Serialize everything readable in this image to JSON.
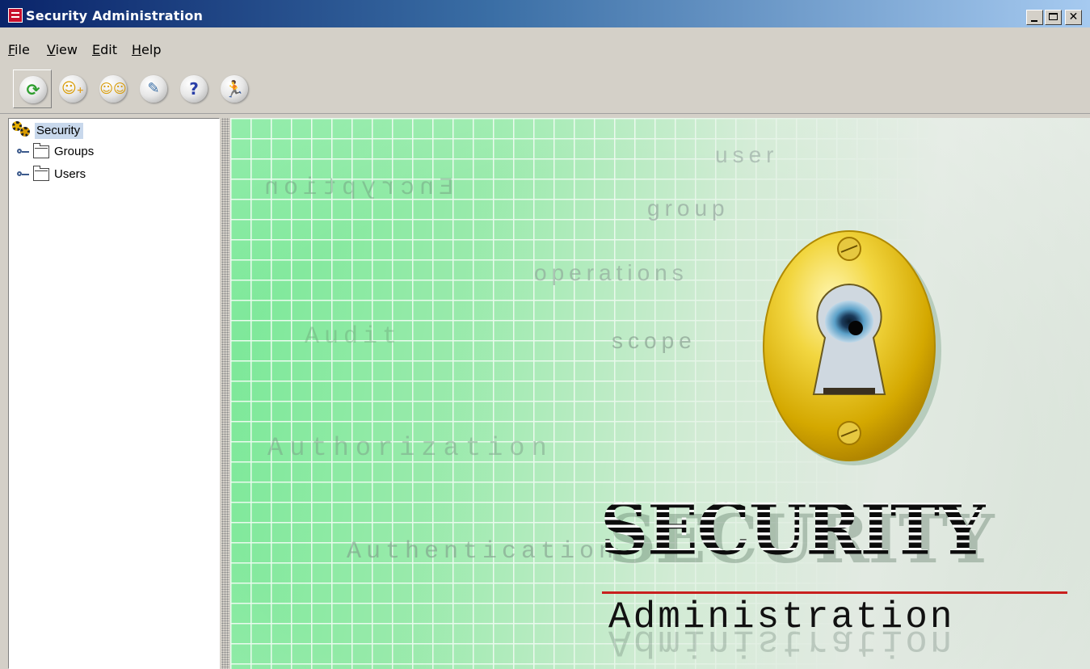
{
  "window": {
    "title": "Security Administration",
    "colors": {
      "titlebar_start": "#0a246a",
      "titlebar_end": "#a6caf0",
      "chrome": "#d4d0c8"
    }
  },
  "menu": {
    "items": [
      {
        "label": "File"
      },
      {
        "label": "View"
      },
      {
        "label": "Edit"
      },
      {
        "label": "Help"
      }
    ]
  },
  "toolbar": {
    "buttons": [
      {
        "icon": "refresh-icon",
        "color": "#2e9e2e"
      },
      {
        "icon": "add-user-icon",
        "color": "#e0a020"
      },
      {
        "icon": "add-group-icon",
        "color": "#e0a020"
      },
      {
        "icon": "edit-icon",
        "color": "#3a6ea5"
      },
      {
        "icon": "help-icon",
        "color": "#2a3fa8"
      },
      {
        "icon": "exit-icon",
        "color": "#e06020"
      }
    ]
  },
  "tree": {
    "root": {
      "label": "Security",
      "icon": "gears-icon"
    },
    "nodes": [
      {
        "label": "Groups",
        "icon": "folder-icon"
      },
      {
        "label": "Users",
        "icon": "folder-icon"
      }
    ]
  },
  "splash": {
    "words": {
      "user": "user",
      "encryption": "Encryption",
      "group": "group",
      "operations": "operations",
      "audit": "Audit",
      "scope": "scope",
      "authorization": "Authorization",
      "authentication": "Authentication"
    },
    "logo_title": "SECURITY",
    "logo_subtitle": "Administration",
    "colors": {
      "grid_green": "#78e896",
      "logo_rule": "#c8201e",
      "lock_gold": "#e8c020"
    }
  }
}
